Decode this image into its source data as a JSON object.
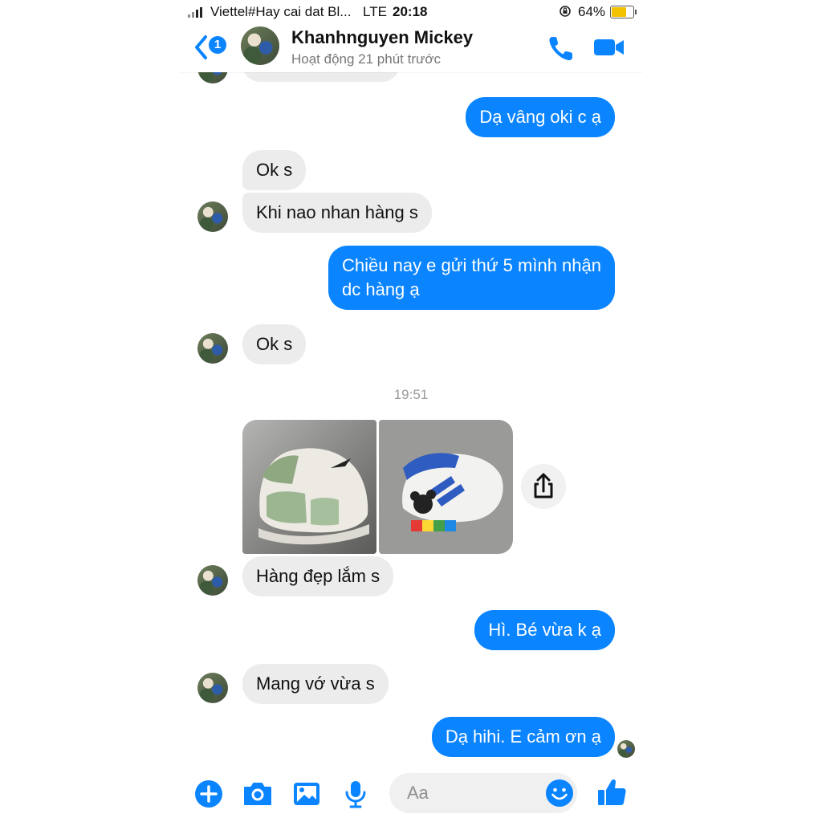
{
  "status_bar": {
    "carrier": "Viettel#Hay cai dat Bl...",
    "network": "LTE",
    "time": "20:18",
    "battery": "64%",
    "battery_level": 0.64
  },
  "header": {
    "back_badge": "1",
    "contact_name": "Khanhnguyen Mickey",
    "activity": "Hoạt động 21 phút trước",
    "icons": [
      "back-chevron-icon",
      "phone-icon",
      "video-camera-icon"
    ]
  },
  "messages": [
    {
      "side": "out",
      "text": "Dạ vâng oki c ạ"
    },
    {
      "side": "in",
      "text": "Ok s"
    },
    {
      "side": "in",
      "text": "Khi nao nhan hàng s"
    },
    {
      "side": "out",
      "lines": [
        "Chiều nay e gửi thứ 5 mình nhận",
        "dc hàng ạ"
      ]
    },
    {
      "side": "in",
      "text": "Ok s"
    },
    {
      "side": "in",
      "text": "Hàng đẹp lắm s"
    },
    {
      "side": "out",
      "text": "Hì. Bé vừa k ạ"
    },
    {
      "side": "in",
      "text": "Mang vớ vừa s"
    },
    {
      "side": "out",
      "text": "Dạ hihi. E cảm ơn ạ"
    }
  ],
  "timestamp": "19:51",
  "composer": {
    "placeholder": "Aa",
    "icons": [
      "plus-icon",
      "camera-icon",
      "image-icon",
      "microphone-icon",
      "emoji-icon",
      "thumbs-up-icon"
    ]
  },
  "colors": {
    "accent": "#0a84ff",
    "incoming_bubble": "#ececec",
    "muted_text": "#777777"
  }
}
